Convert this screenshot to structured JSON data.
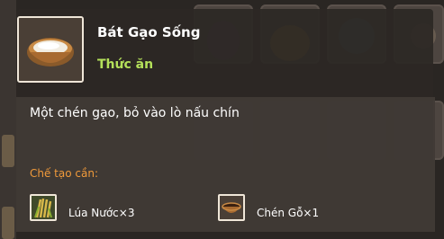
{
  "item": {
    "name": "Bát Gạo Sống",
    "category": "Thức ăn",
    "description": "Một chén gạo, bỏ vào lò nấu chín",
    "icon": "rice-bowl-icon"
  },
  "crafting": {
    "label": "Chế tạo cần:",
    "materials": [
      {
        "label": "Lúa Nước×3",
        "icon": "rice-plant-icon"
      },
      {
        "label": "Chén Gỗ×1",
        "icon": "wooden-bowl-icon"
      }
    ]
  },
  "colors": {
    "title": "#ffffff",
    "category": "#b4e05a",
    "requirement_label": "#f09a3b",
    "panel": "#2c2825"
  }
}
